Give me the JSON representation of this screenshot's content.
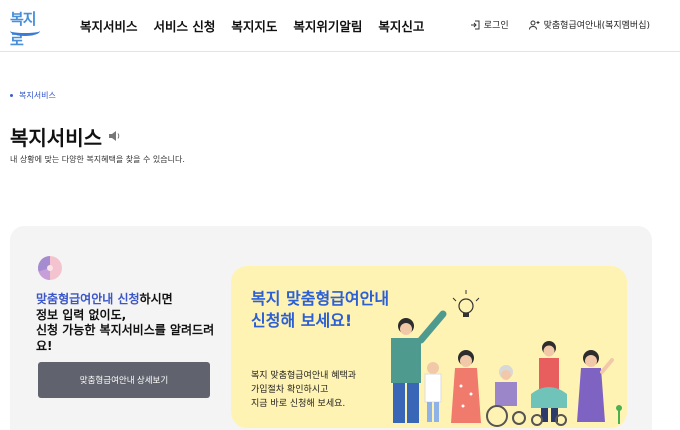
{
  "header": {
    "logo_text": "복지로",
    "nav": [
      "복지서비스",
      "서비스 신청",
      "복지지도",
      "복지위기알림",
      "복지신고"
    ],
    "login_label": "로그인",
    "membership_label": "맞춤형급여안내(복지멤버십)"
  },
  "breadcrumb": {
    "label": "복지서비스"
  },
  "page": {
    "title": "복지서비스",
    "description": "내 상황에 맞는 다양한 복지혜택을 찾을 수 있습니다."
  },
  "promo": {
    "highlight": "맞춤형급여안내 신청",
    "text_after_highlight": "하시면",
    "line2": "정보 입력 없이도,",
    "line3": "신청 가능한 복지서비스를 알려드려",
    "line4": "요!",
    "button_label": "맞춤형급여안내 상세보기"
  },
  "banner": {
    "headline_line1": "복지 맞춤형급여안내",
    "headline_line2": "신청해 보세요!",
    "body_line1": "복지 맞춤형급여안내 혜택과",
    "body_line2": "가입절차 확인하시고",
    "body_line3": "지금 바로 신청해 보세요."
  },
  "colors": {
    "accent_blue": "#2b5fd6",
    "highlight_blue": "#3a56c8",
    "banner_bg": "#fff3b3",
    "panel_bg": "#f4f4f4",
    "button_bg": "#60636d"
  },
  "icons": {
    "login": "login-icon",
    "membership": "add-user-icon",
    "speaker": "speaker-icon",
    "pie": "pie-chart-icon"
  }
}
